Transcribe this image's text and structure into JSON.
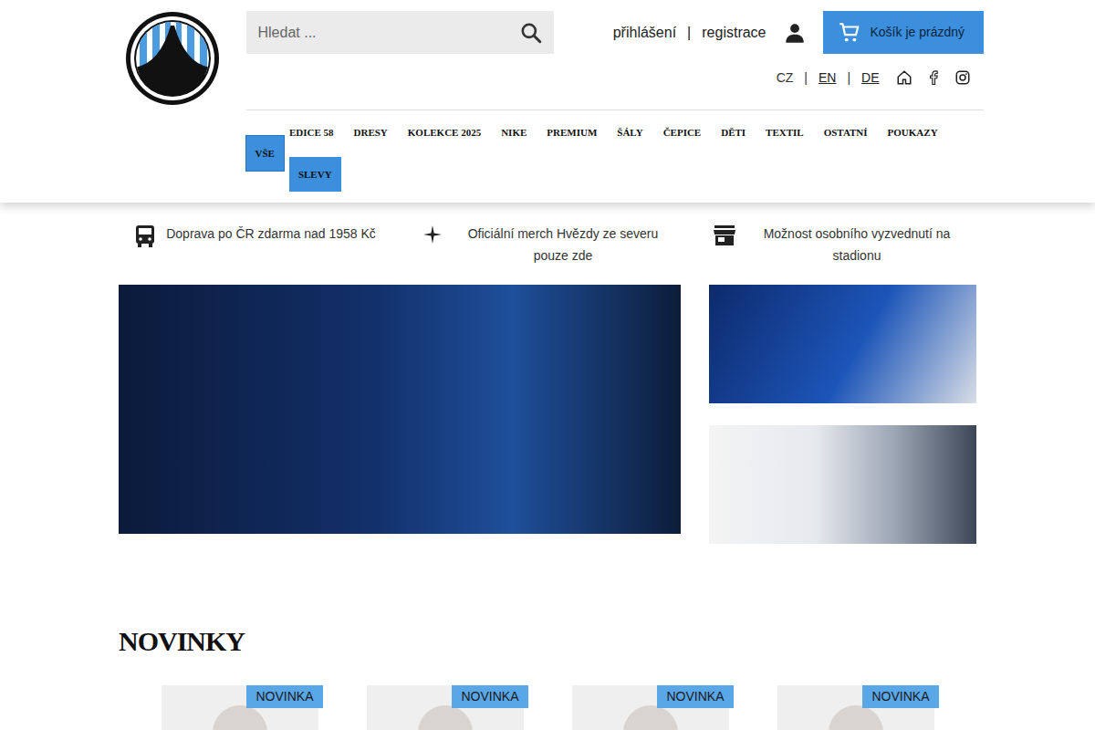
{
  "search": {
    "placeholder": "Hledat ..."
  },
  "account": {
    "login": "přihlášení",
    "separator": "|",
    "register": "registrace"
  },
  "cart": {
    "label": "Košík je prázdný"
  },
  "languages": [
    {
      "label": "CZ",
      "selected": true
    },
    {
      "label": "EN",
      "selected": false
    },
    {
      "label": "DE",
      "selected": false
    }
  ],
  "language_separator": "|",
  "nav": [
    {
      "label": "VŠE",
      "selected": true,
      "highlighted": true
    },
    {
      "label": "EDICE 58",
      "selected": false,
      "highlighted": false
    },
    {
      "label": "DRESY",
      "selected": false,
      "highlighted": false
    },
    {
      "label": "KOLEKCE 2025",
      "selected": false,
      "highlighted": false
    },
    {
      "label": "NIKE",
      "selected": false,
      "highlighted": false
    },
    {
      "label": "PREMIUM",
      "selected": false,
      "highlighted": false
    },
    {
      "label": "ŠÁLY",
      "selected": false,
      "highlighted": false
    },
    {
      "label": "ČEPICE",
      "selected": false,
      "highlighted": false
    },
    {
      "label": "DĚTI",
      "selected": false,
      "highlighted": false
    },
    {
      "label": "TEXTIL",
      "selected": false,
      "highlighted": false
    },
    {
      "label": "OSTATNÍ",
      "selected": false,
      "highlighted": false
    },
    {
      "label": "POUKAZY",
      "selected": false,
      "highlighted": false
    },
    {
      "label": "SLEVY",
      "selected": false,
      "highlighted": true
    }
  ],
  "benefits": [
    {
      "text": "Doprava po ČR zdarma nad 1958 Kč",
      "kind": "bus"
    },
    {
      "text": "Oficiální merch Hvězdy ze severu pouze zde",
      "kind": "star"
    },
    {
      "text": "Možnost osobního vyzvednutí na stadionu",
      "kind": "store"
    }
  ],
  "novinky": {
    "title": "NOVINKY",
    "products": [
      {
        "badge": "NOVINKA"
      },
      {
        "badge": "NOVINKA"
      },
      {
        "badge": "NOVINKA"
      },
      {
        "badge": "NOVINKA"
      }
    ]
  }
}
